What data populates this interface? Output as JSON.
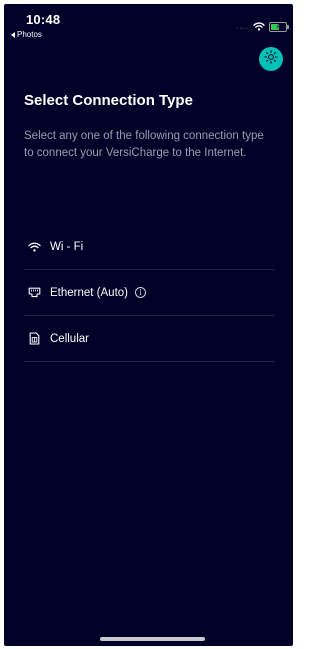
{
  "status_bar": {
    "time": "10:48",
    "back_app_label": "Photos",
    "signal_dots": "....",
    "wifi_icon": "wifi-icon",
    "battery_icon": "battery-charging-icon",
    "battery_level": 0.6
  },
  "header": {
    "theme_toggle_icon": "sun-icon",
    "accent_color": "#00c1b6"
  },
  "main": {
    "title": "Select Connection Type",
    "description": "Select any one of the following connection type to connect your VersiCharge to the Internet."
  },
  "options": [
    {
      "label": "Wi - Fi",
      "icon": "wifi-icon"
    },
    {
      "label": "Ethernet (Auto)",
      "icon": "ethernet-icon",
      "info_icon": "info-icon",
      "info_glyph": "i"
    },
    {
      "label": "Cellular",
      "icon": "sim-card-icon"
    }
  ],
  "colors": {
    "background": "#000028",
    "secondary_text": "#9d9dae",
    "divider": "#23233e"
  }
}
